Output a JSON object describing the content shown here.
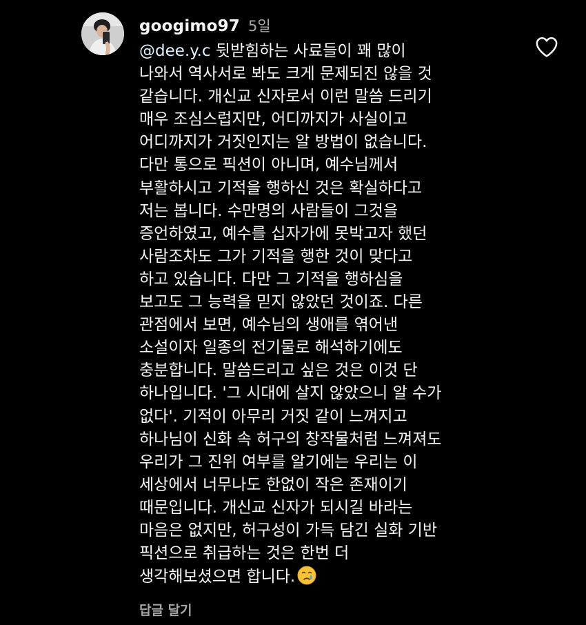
{
  "comment": {
    "username": "googimo97",
    "timestamp": "5일",
    "mention": "@dee.y.c",
    "lines": [
      " 뒷받힘하는 사료들이 꽤 많이",
      "나와서 역사서로 봐도 크게 문제되진 않을 것",
      "같습니다. 개신교 신자로서 이런 말씀 드리기",
      "매우 조심스럽지만, 어디까지가 사실이고",
      "어디까지가 거짓인지는 알 방법이 없습니다.",
      "다만 통으로 픽션이 아니며, 예수님께서",
      "부활하시고 기적을 행하신 것은 확실하다고",
      "저는 봅니다. 수만명의 사람들이 그것을",
      "증언하였고, 예수를 십자가에 못박고자 했던",
      "사람조차도 그가 기적을 행한 것이 맞다고",
      "하고 있습니다. 다만 그 기적을 행하심을",
      "보고도 그 능력을 믿지 않았던 것이죠. 다른",
      "관점에서 보면, 예수님의 생애를 엮어낸",
      "소설이자 일종의 전기물로 해석하기에도",
      "충분합니다. 말씀드리고 싶은 것은 이것 단",
      "하나입니다. '그 시대에 살지 않았으니 알 수가",
      "없다'. 기적이 아무리 거짓 같이 느껴지고",
      "하나님이 신화 속 허구의 창작물처럼 느껴져도",
      "우리가 그 진위 여부를 알기에는 우리는 이",
      "세상에서 너무나도 한없이 작은 존재이기",
      "때문입니다. 개신교 신자가 되시길 바라는",
      "마음은 없지만, 허구성이 가득 담긴 실화 기반",
      "픽션으로 취급하는 것은 한번 더",
      "생각해보셨으면 합니다."
    ],
    "emoji_icon": "crying-face-emoji-icon",
    "reply_label": "답글 달기",
    "like_icon": "heart-outline-icon"
  }
}
